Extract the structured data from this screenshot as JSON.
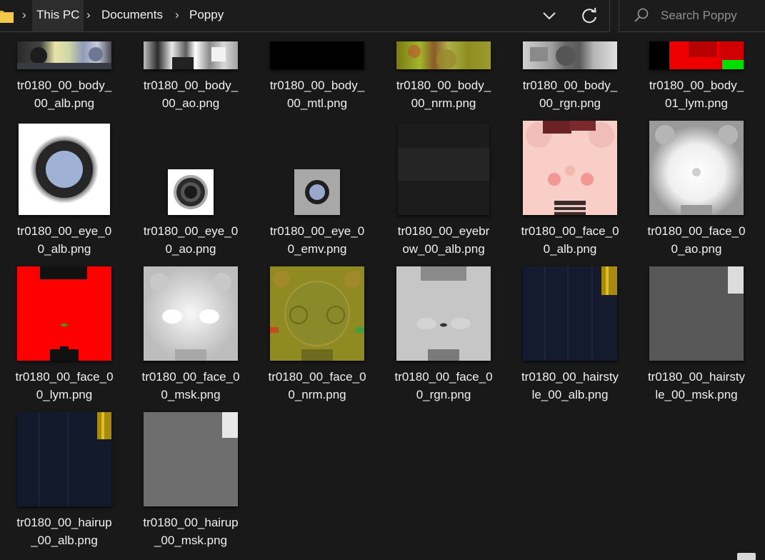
{
  "address_bar": {
    "breadcrumbs": [
      "This PC",
      "Documents",
      "Poppy"
    ],
    "folder_icon": "folder-icon",
    "dropdown_icon": "chevron-down-icon",
    "refresh_icon": "refresh-icon"
  },
  "search": {
    "placeholder": "Search Poppy",
    "icon": "search-icon"
  },
  "files": [
    {
      "name": "tr0180_00_body_\n00_alb.png",
      "thumb": "body-alb"
    },
    {
      "name": "tr0180_00_body_\n00_ao.png",
      "thumb": "body-ao"
    },
    {
      "name": "tr0180_00_body_\n00_mtl.png",
      "thumb": "body-mtl"
    },
    {
      "name": "tr0180_00_body_\n00_nrm.png",
      "thumb": "body-nrm"
    },
    {
      "name": "tr0180_00_body_\n00_rgn.png",
      "thumb": "body-rgn"
    },
    {
      "name": "tr0180_00_body_\n01_lym.png",
      "thumb": "body-lym"
    },
    {
      "name": "tr0180_00_eye_0\n0_alb.png",
      "thumb": "eye-alb"
    },
    {
      "name": "tr0180_00_eye_0\n0_ao.png",
      "thumb": "eye-ao"
    },
    {
      "name": "tr0180_00_eye_0\n0_emv.png",
      "thumb": "eye-emv"
    },
    {
      "name": "tr0180_00_eyebr\now_00_alb.png",
      "thumb": "eyebrow-alb"
    },
    {
      "name": "tr0180_00_face_0\n0_alb.png",
      "thumb": "face-alb"
    },
    {
      "name": "tr0180_00_face_0\n0_ao.png",
      "thumb": "face-ao"
    },
    {
      "name": "tr0180_00_face_0\n0_lym.png",
      "thumb": "face-lym"
    },
    {
      "name": "tr0180_00_face_0\n0_msk.png",
      "thumb": "face-msk"
    },
    {
      "name": "tr0180_00_face_0\n0_nrm.png",
      "thumb": "face-nrm"
    },
    {
      "name": "tr0180_00_face_0\n0_rgn.png",
      "thumb": "face-rgn"
    },
    {
      "name": "tr0180_00_hairsty\nle_00_alb.png",
      "thumb": "hairstyle-alb"
    },
    {
      "name": "tr0180_00_hairsty\nle_00_msk.png",
      "thumb": "hairstyle-msk"
    },
    {
      "name": "tr0180_00_hairup\n_00_alb.png",
      "thumb": "hairup-alb"
    },
    {
      "name": "tr0180_00_hairup\n_00_msk.png",
      "thumb": "hairup-msk"
    }
  ]
}
